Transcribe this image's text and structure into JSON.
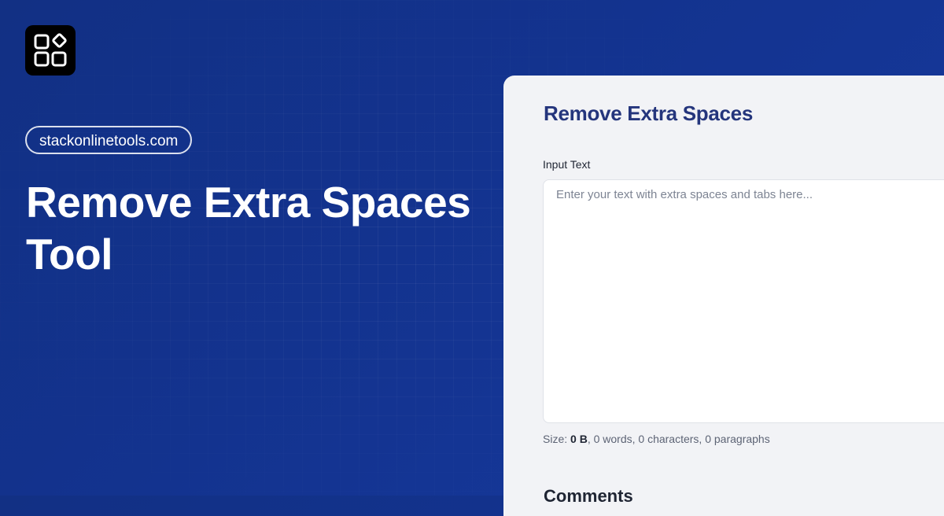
{
  "brand": {
    "domain": "stackonlinetools.com",
    "logo_icon": "shapes-grid-icon"
  },
  "hero": {
    "title": "Remove Extra Spaces Tool"
  },
  "tool_panel": {
    "title": "Remove Extra Spaces",
    "input_label": "Input Text",
    "input_placeholder": "Enter your text with extra spaces and tabs here...",
    "input_value": "",
    "stats": {
      "size_label": "Size:",
      "size_value": "0 B",
      "rest": ", 0 words, 0 characters, 0 paragraphs"
    },
    "comments_heading": "Comments"
  },
  "colors": {
    "background": "#13338f",
    "panel": "#f2f3f6",
    "panel_title": "#24357c",
    "hero_text": "#ffffff",
    "logo_bg": "#000000"
  }
}
